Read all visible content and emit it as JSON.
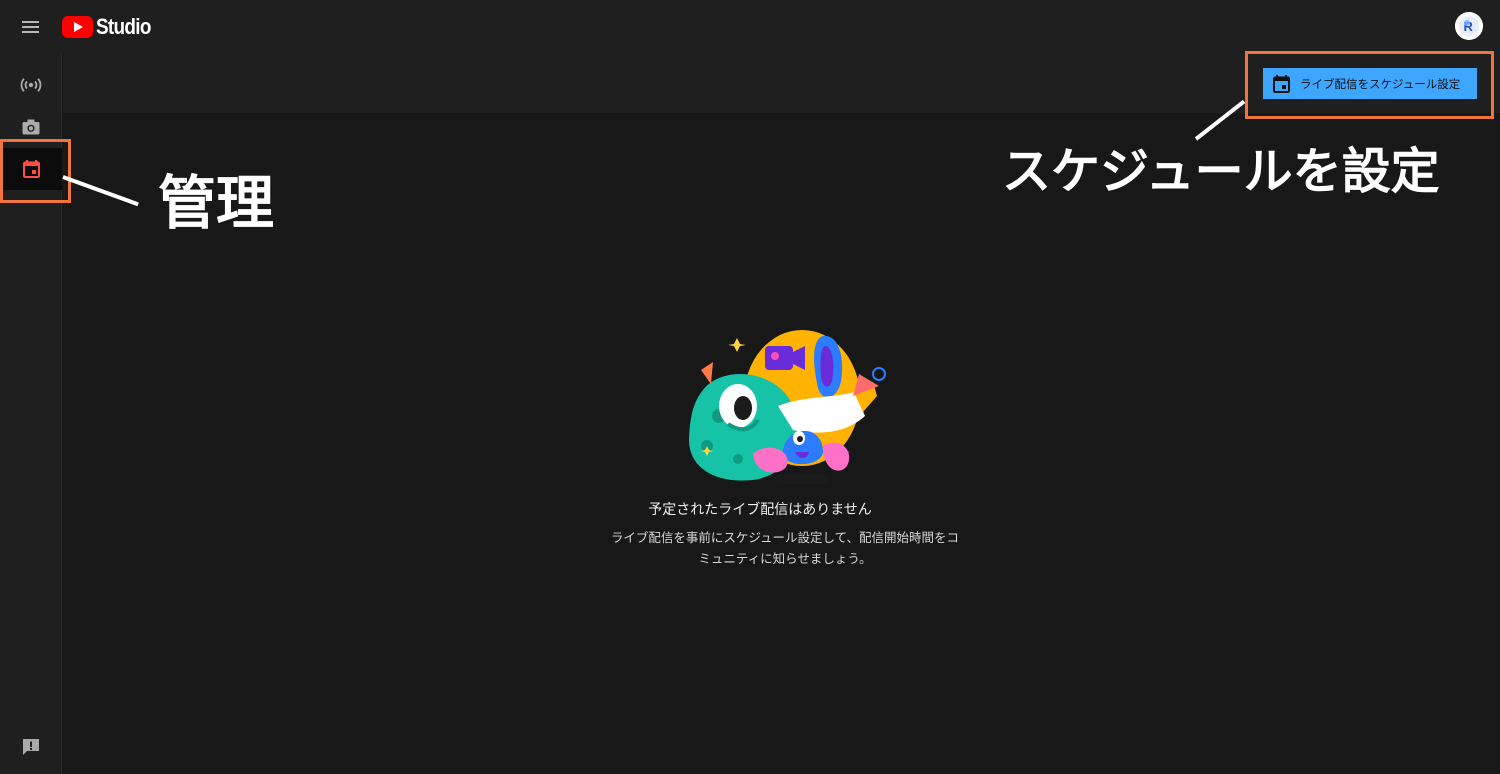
{
  "header": {
    "logo_text": "Studio",
    "menu_icon": "hamburger-icon",
    "avatar_icon": "channel-avatar"
  },
  "sidebar": {
    "items": [
      {
        "name": "live-broadcast-icon"
      },
      {
        "name": "camera-icon"
      },
      {
        "name": "calendar-icon",
        "active": true
      }
    ],
    "feedback_icon": "feedback-icon"
  },
  "toolbar": {
    "schedule_button_label": "ライブ配信をスケジュール設定",
    "schedule_button_icon": "calendar-icon"
  },
  "empty_state": {
    "title": "予定されたライブ配信はありません",
    "description": "ライブ配信を事前にスケジュール設定して、配信開始時間をコミュニティに知らせましょう。"
  },
  "annotations": {
    "manage_label": "管理",
    "schedule_label": "スケジュールを設定"
  },
  "colors": {
    "accent": "#3ea6ff",
    "highlight": "#f1743a",
    "brand_red": "#ff0000",
    "active_icon": "#ff4e45",
    "background": "#181818",
    "bar_background": "#1f1f1f"
  }
}
